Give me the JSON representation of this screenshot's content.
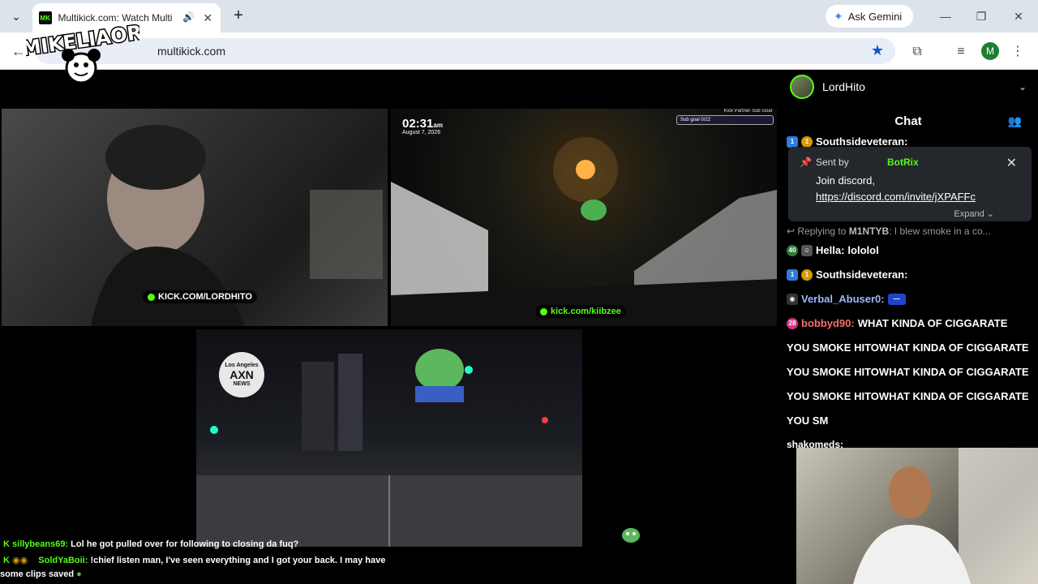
{
  "browser": {
    "tab_title": "Multikick.com: Watch Multi",
    "favicon_text": "MK",
    "url": "multikick.com",
    "gemini_label": "Ask Gemini",
    "profile_initial": "M"
  },
  "overlay_logo": "MIKELIAOR",
  "videos": {
    "v1_tag": "KICK.COM/LORDHITO",
    "v2_clock": "02:31",
    "v2_ampm": "am",
    "v2_date": "August 7, 2026",
    "v2_goal_title": "Kick Partner Sub Goal",
    "v2_goal_value": "Sub goal 0/22",
    "v2_tag": "kick.com/kiibzee",
    "v3_logo_top": "Los Angeles",
    "v3_logo_mid": "AXN",
    "v3_logo_bottom": "NEWS"
  },
  "chat": {
    "channel": "LordHito",
    "title": "Chat",
    "top_user": "Southsideveteran:",
    "pinned": {
      "sent_by": "Sent by",
      "user": "BotRix",
      "text": "Join discord,",
      "link": "https://discord.com/invite/jXPAFFc",
      "expand": "Expand"
    },
    "reply_prefix": "Replying to",
    "reply_user": "M1NTYB",
    "reply_text": ": I blew smoke in a co...",
    "messages": [
      {
        "user": "Hella:",
        "text": "lololol",
        "color": "#ffffff"
      },
      {
        "user": "Southsideveteran:",
        "text": "",
        "color": "#ffffff"
      },
      {
        "user": "Verbal_Abuser0:",
        "text": "",
        "color": "#9bb8ff"
      },
      {
        "user": "bobbyd90:",
        "text": "WHAT KINDA OF CIGGARATE",
        "color": "#ff6b6b"
      }
    ],
    "long_lines": [
      "YOU SMOKE HITOWHAT KINDA OF CIGGARATE",
      "YOU SMOKE HITOWHAT KINDA OF CIGGARATE",
      "YOU SMOKE HITOWHAT KINDA OF CIGGARATE",
      "YOU SM"
    ],
    "last_user": "shakomeds:"
  },
  "overlay_chat": [
    {
      "user": "sillybeans69:",
      "text": "Lol he got pulled over for following to closing da fuq?"
    },
    {
      "user": "SoldYaBoii:",
      "text": "!chief listen man, I've seen everything and I got your back. I may have"
    },
    {
      "user": "",
      "text": "some clips saved"
    }
  ]
}
